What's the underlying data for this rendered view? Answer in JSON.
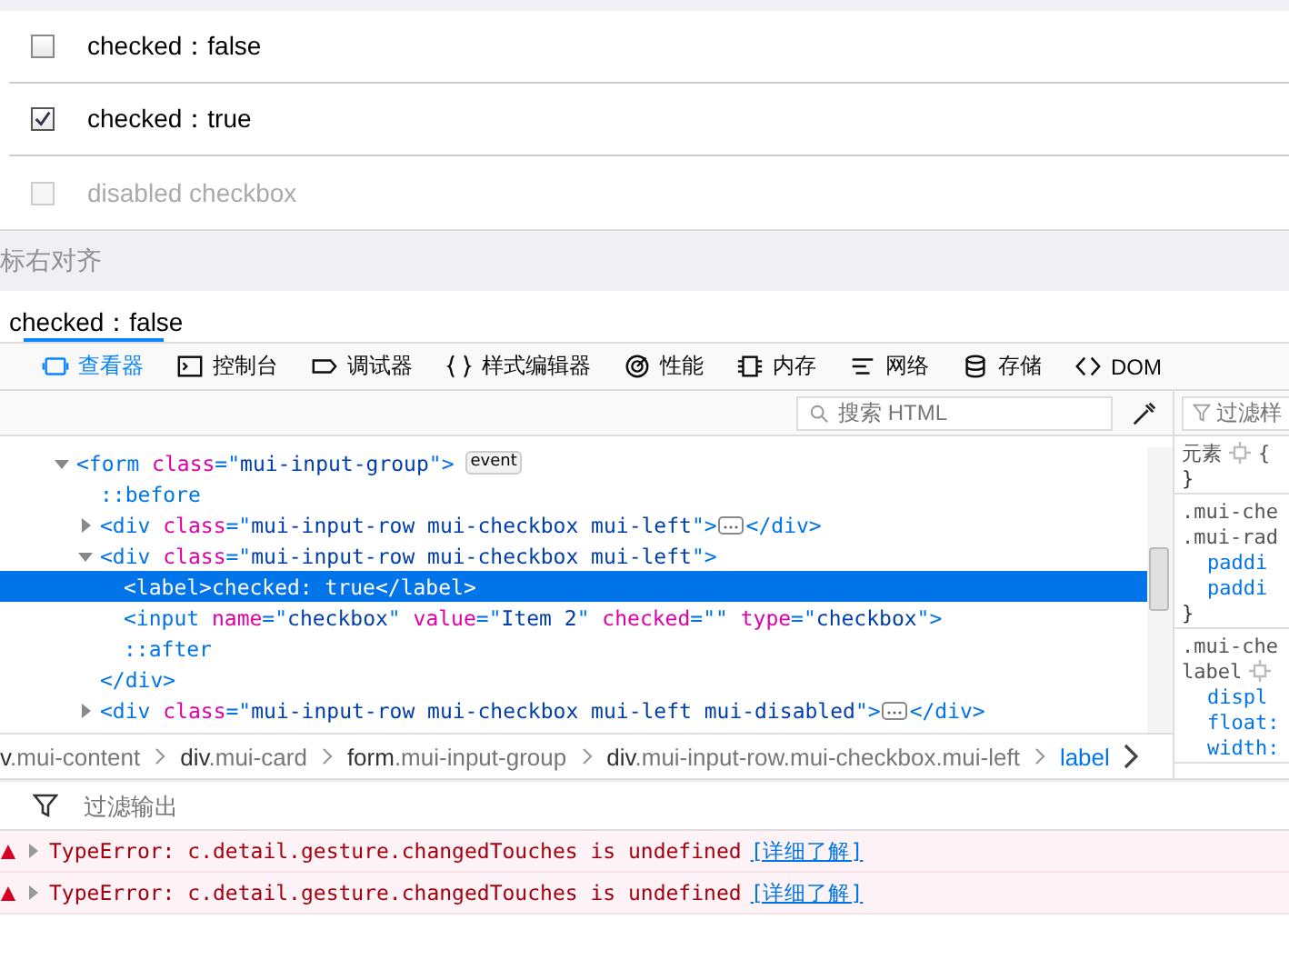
{
  "page": {
    "checkboxes": [
      {
        "label": "checked：false",
        "checked": false,
        "disabled": false
      },
      {
        "label": "checked：true",
        "checked": true,
        "disabled": false
      },
      {
        "label": "disabled checkbox",
        "checked": false,
        "disabled": true
      }
    ],
    "section_title": "标右对齐",
    "next_row_label": "checked：false"
  },
  "devtools": {
    "tabs": [
      {
        "label": "查看器",
        "selected": true
      },
      {
        "label": "控制台",
        "selected": false
      },
      {
        "label": "调试器",
        "selected": false
      },
      {
        "label": "样式编辑器",
        "selected": false
      },
      {
        "label": "性能",
        "selected": false
      },
      {
        "label": "内存",
        "selected": false
      },
      {
        "label": "网络",
        "selected": false
      },
      {
        "label": "存储",
        "selected": false
      },
      {
        "label": "DOM",
        "selected": false
      }
    ],
    "search": {
      "placeholder": "搜索 HTML"
    },
    "rules_filter": {
      "placeholder": "过滤样"
    },
    "markup": [
      {
        "segments": [
          {
            "text": "<form",
            "kind": "tag"
          },
          {
            "text": " class",
            "kind": "attr"
          },
          {
            "text": "=\"",
            "kind": "tag"
          },
          {
            "text": "mui-input-group",
            "kind": "value"
          },
          {
            "text": "\">",
            "kind": "tag"
          }
        ],
        "badge": "event",
        "expanded": true,
        "selected": false,
        "children": [
          {
            "segments": [
              {
                "text": "::before",
                "kind": "pseudo"
              }
            ],
            "selected": false
          },
          {
            "segments": [
              {
                "text": "<div",
                "kind": "tag"
              },
              {
                "text": " class",
                "kind": "attr"
              },
              {
                "text": "=\"",
                "kind": "tag"
              },
              {
                "text": "mui-input-row mui-checkbox mui-left",
                "kind": "value"
              },
              {
                "text": "\">",
                "kind": "tag"
              }
            ],
            "expanded": false,
            "selected": false,
            "close": "</div>"
          },
          {
            "segments": [
              {
                "text": "<div",
                "kind": "tag"
              },
              {
                "text": " class",
                "kind": "attr"
              },
              {
                "text": "=\"",
                "kind": "tag"
              },
              {
                "text": "mui-input-row mui-checkbox mui-left",
                "kind": "value"
              },
              {
                "text": "\">",
                "kind": "tag"
              }
            ],
            "expanded": true,
            "selected": false,
            "close": "</div>",
            "children": [
              {
                "segments": [
                  {
                    "text": "<label>",
                    "kind": "tag"
                  },
                  {
                    "text": "checked: true",
                    "kind": "text"
                  },
                  {
                    "text": "</label>",
                    "kind": "tag"
                  }
                ],
                "selected": true
              },
              {
                "segments": [
                  {
                    "text": "<input",
                    "kind": "tag"
                  },
                  {
                    "text": " name",
                    "kind": "attr"
                  },
                  {
                    "text": "=\"",
                    "kind": "tag"
                  },
                  {
                    "text": "checkbox",
                    "kind": "value"
                  },
                  {
                    "text": "\"",
                    "kind": "tag"
                  },
                  {
                    "text": " value",
                    "kind": "attr"
                  },
                  {
                    "text": "=\"",
                    "kind": "tag"
                  },
                  {
                    "text": "Item 2",
                    "kind": "value"
                  },
                  {
                    "text": "\"",
                    "kind": "tag"
                  },
                  {
                    "text": " checked",
                    "kind": "attr"
                  },
                  {
                    "text": "=\"\"",
                    "kind": "tag"
                  },
                  {
                    "text": " type",
                    "kind": "attr"
                  },
                  {
                    "text": "=\"",
                    "kind": "tag"
                  },
                  {
                    "text": "checkbox",
                    "kind": "value"
                  },
                  {
                    "text": "\">",
                    "kind": "tag"
                  }
                ],
                "selected": false
              },
              {
                "segments": [
                  {
                    "text": "::after",
                    "kind": "pseudo"
                  }
                ],
                "selected": false
              }
            ]
          },
          {
            "segments": [
              {
                "text": "<div",
                "kind": "tag"
              },
              {
                "text": " class",
                "kind": "attr"
              },
              {
                "text": "=\"",
                "kind": "tag"
              },
              {
                "text": "mui-input-row mui-checkbox mui-left mui-disabled",
                "kind": "value"
              },
              {
                "text": "\">",
                "kind": "tag"
              }
            ],
            "expanded": false,
            "selected": false,
            "close": "</div>"
          }
        ]
      }
    ],
    "breadcrumbs": [
      {
        "tag": "v",
        "classes": ".mui-content",
        "selected": false
      },
      {
        "tag": "div",
        "classes": ".mui-card",
        "selected": false
      },
      {
        "tag": "form",
        "classes": ".mui-input-group",
        "selected": false
      },
      {
        "tag": "div",
        "classes": ".mui-input-row.mui-checkbox.mui-left",
        "selected": false
      },
      {
        "tag": "label",
        "selected": true
      }
    ],
    "rules": [
      {
        "lines": [
          {
            "text": "元素",
            "kind": "selector",
            "icon": true,
            "after": "{"
          },
          {
            "text": "}",
            "kind": "brace"
          }
        ]
      },
      {
        "lines": [
          {
            "text": ".mui-che",
            "kind": "selector"
          },
          {
            "text": ".mui-rad",
            "kind": "selector"
          },
          {
            "text": "paddi",
            "kind": "property"
          },
          {
            "text": "paddi",
            "kind": "property"
          },
          {
            "text": "}",
            "kind": "brace"
          }
        ]
      },
      {
        "lines": [
          {
            "text": ".mui-che",
            "kind": "selector"
          },
          {
            "text": "label",
            "kind": "selector",
            "icon": true
          },
          {
            "text": "displ",
            "kind": "property"
          },
          {
            "text": "float:",
            "kind": "property"
          },
          {
            "text": "width:",
            "kind": "property"
          }
        ]
      }
    ],
    "console": {
      "filter_placeholder": "过滤输出",
      "messages": [
        {
          "kind": "error",
          "text": "TypeError: c.detail.gesture.changedTouches is undefined",
          "link": "[详细了解]"
        },
        {
          "kind": "error",
          "text": "TypeError: c.detail.gesture.changedTouches is undefined",
          "link": "[详细了解]"
        }
      ]
    }
  }
}
